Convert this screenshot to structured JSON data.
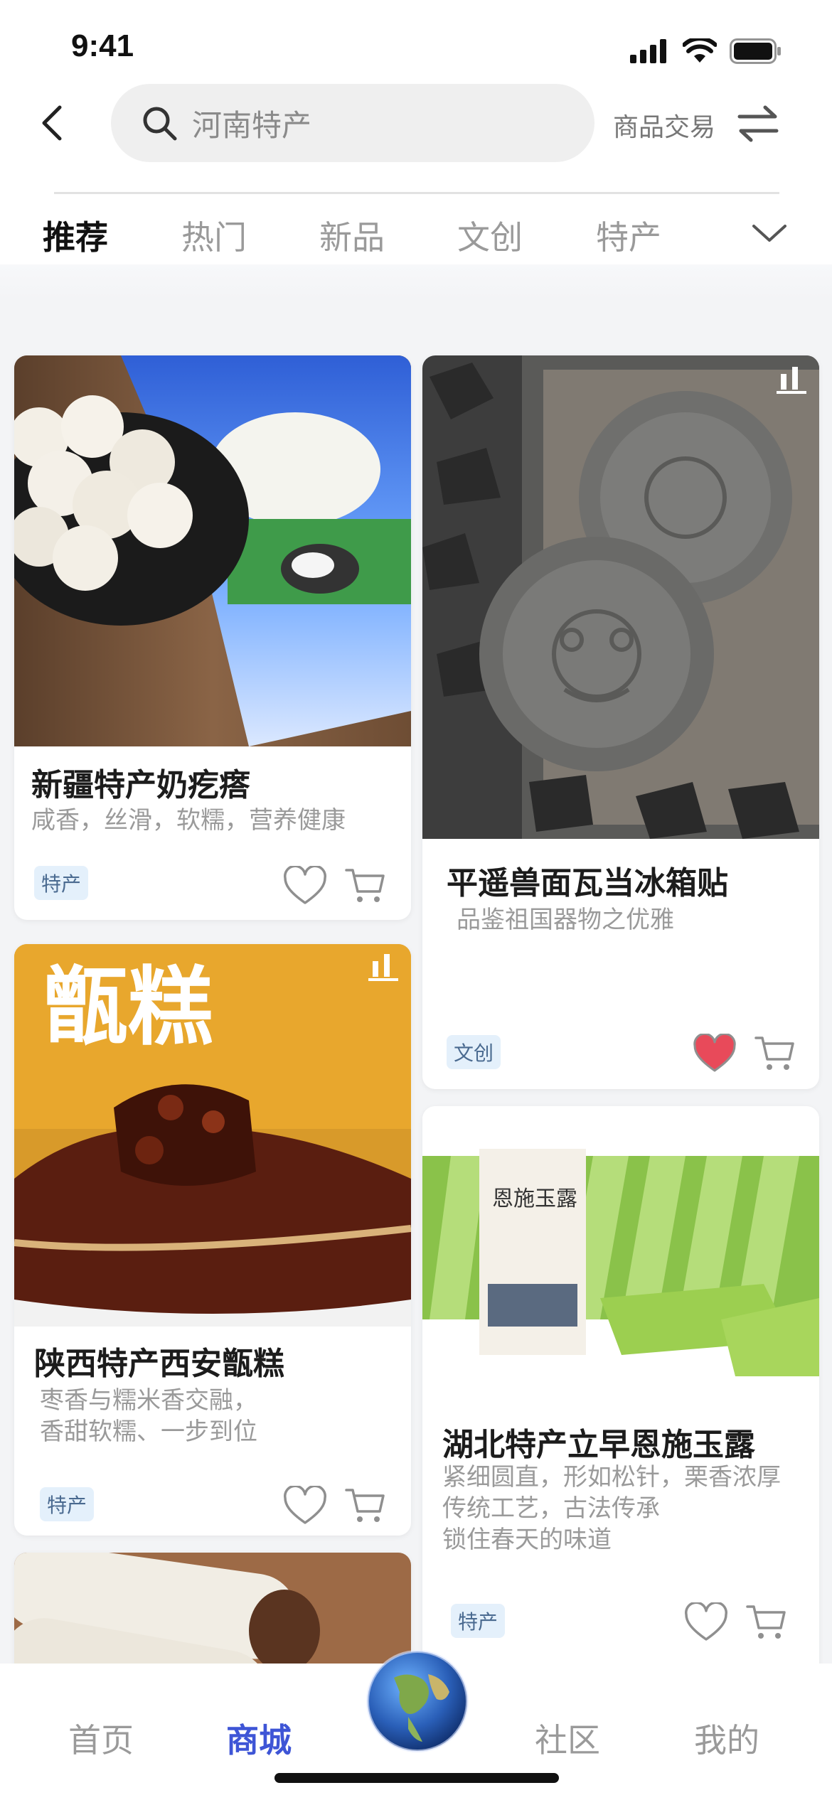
{
  "status": {
    "time": "9:41"
  },
  "header": {
    "search_placeholder": "河南特产",
    "trade_label": "商品交易"
  },
  "tabs": [
    {
      "label": "推荐",
      "active": true
    },
    {
      "label": "热门",
      "active": false
    },
    {
      "label": "新品",
      "active": false
    },
    {
      "label": "文创",
      "active": false
    },
    {
      "label": "特产",
      "active": false
    }
  ],
  "products": [
    {
      "title": "新疆特产奶疙瘩",
      "desc": [
        "咸香，丝滑，软糯，营养健康"
      ],
      "badge": "特产",
      "favorited": false,
      "image": "milk-cheese-balls-photo"
    },
    {
      "title": "平遥兽面瓦当冰箱贴",
      "desc": [
        "品鉴祖国器物之优雅"
      ],
      "badge": "文创",
      "favorited": true,
      "image": "stone-tile-magnet-photo"
    },
    {
      "title": "陕西特产西安甑糕",
      "desc": [
        "枣香与糯米香交融，",
        "香甜软糯、一步到位"
      ],
      "badge": "特产",
      "favorited": false,
      "image": "zeng-gao-cake-photo"
    },
    {
      "title": "湖北特产立早恩施玉露",
      "desc": [
        "紧细圆直，形如松针，栗香浓厚",
        "传统工艺，古法传承",
        "锁住春天的味道"
      ],
      "badge": "特产",
      "favorited": false,
      "image": "enshi-yulu-tea-photo"
    },
    {
      "title": "",
      "desc": [],
      "badge": "",
      "favorited": false,
      "image": "rice-roll-dessert-photo"
    }
  ],
  "bottom_nav": [
    {
      "label": "首页",
      "active": false
    },
    {
      "label": "商城",
      "active": true
    },
    {
      "label": "社区",
      "active": false
    },
    {
      "label": "我的",
      "active": false
    }
  ],
  "colors": {
    "accent": "#3e55d6",
    "favorite": "#e84a5a",
    "badge_bg": "#e4f0fb"
  }
}
